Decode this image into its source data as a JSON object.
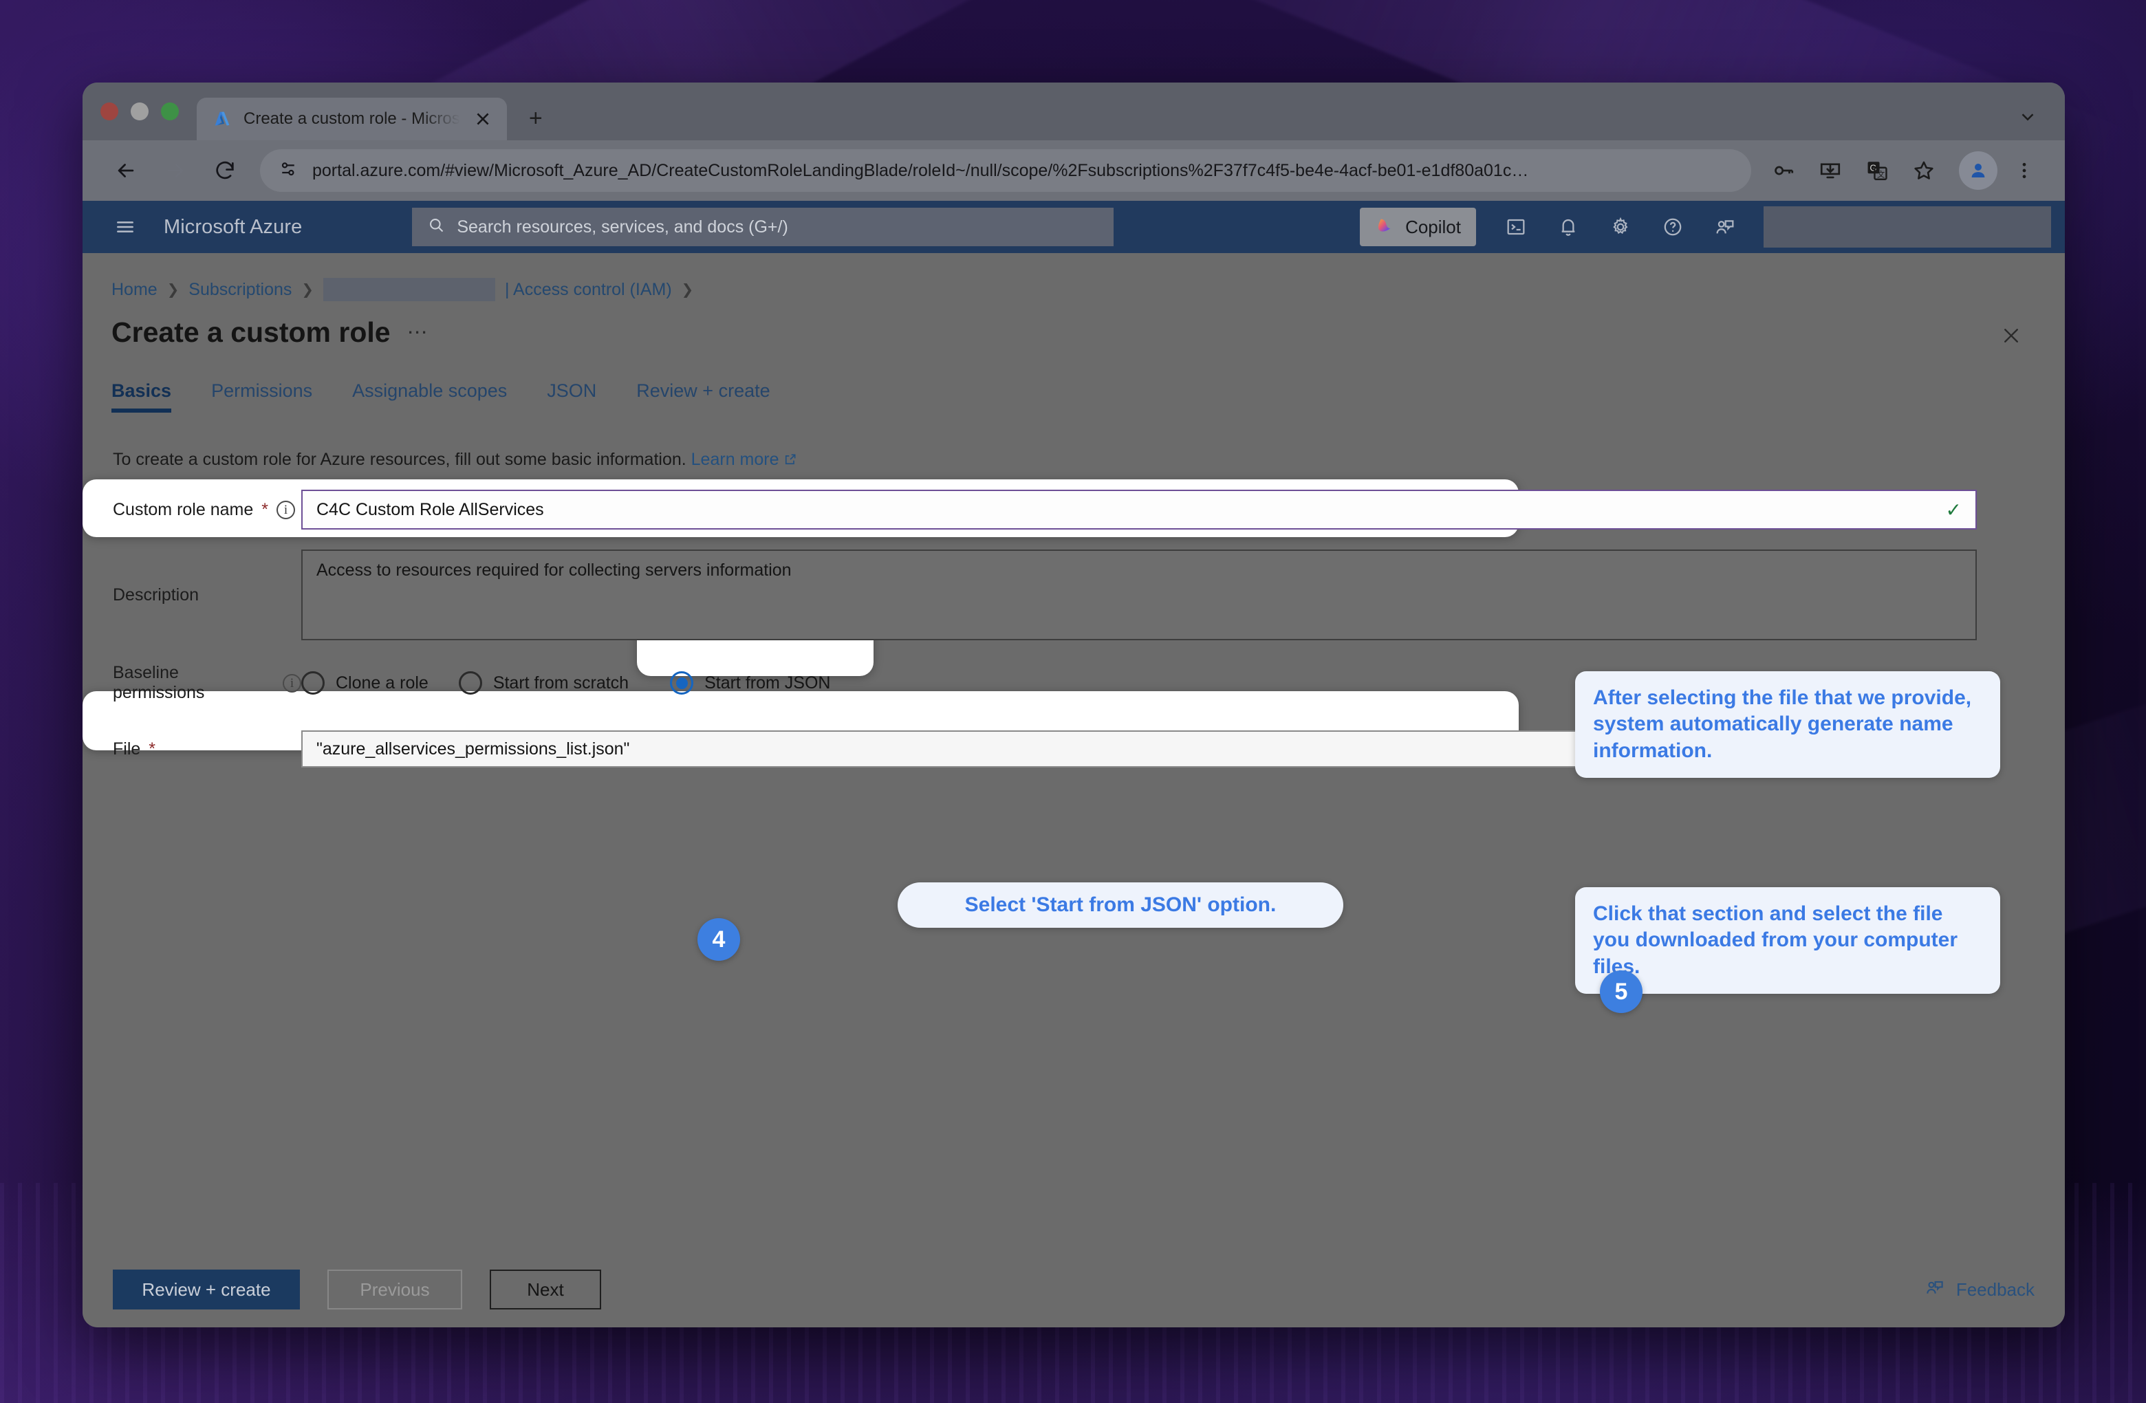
{
  "browser": {
    "tab": {
      "title": "Create a custom role - Micros",
      "favicon": "azure-logo-icon",
      "close": "×"
    },
    "newtab_label": "+",
    "url": "portal.azure.com/#view/Microsoft_Azure_AD/CreateCustomRoleLandingBlade/roleId~/null/scope/%2Fsubscriptions%2F37f7c4f5-be4e-4acf-be01-e1df80a01c…",
    "toolbar_icons": [
      "back-arrow-icon",
      "forward-arrow-icon",
      "reload-icon",
      "site-settings-icon",
      "password-key-icon",
      "install-app-icon",
      "translate-icon",
      "bookmark-star-icon",
      "profile-avatar-icon",
      "chrome-menu-icon"
    ]
  },
  "azure_header": {
    "menu_icon": "hamburger-menu-icon",
    "brand": "Microsoft Azure",
    "search_placeholder": "Search resources, services, and docs (G+/)",
    "search_icon": "search-icon",
    "copilot_label": "Copilot",
    "copilot_icon": "copilot-icon",
    "icons": [
      "cloud-shell-icon",
      "notifications-bell-icon",
      "settings-gear-icon",
      "help-question-icon",
      "feedback-person-icon"
    ],
    "account_redacted": true
  },
  "breadcrumb": {
    "items": [
      {
        "label": "Home",
        "type": "link"
      },
      {
        "label": "Subscriptions",
        "type": "link"
      },
      {
        "label": "",
        "type": "redacted"
      },
      {
        "label": "| Access control (IAM)",
        "type": "link"
      }
    ],
    "separator": "❯"
  },
  "blade": {
    "title": "Create a custom role",
    "more_actions": "⋯",
    "close_icon": "close-icon",
    "tabs": [
      {
        "label": "Basics",
        "active": true
      },
      {
        "label": "Permissions",
        "active": false
      },
      {
        "label": "Assignable scopes",
        "active": false
      },
      {
        "label": "JSON",
        "active": false
      },
      {
        "label": "Review + create",
        "active": false
      }
    ],
    "intro_text": "To create a custom role for Azure resources, fill out some basic information.",
    "intro_link": "Learn more",
    "intro_link_icon": "external-link-icon"
  },
  "form": {
    "role_name": {
      "label": "Custom role name",
      "required_mark": "*",
      "info_icon": "info-icon",
      "value": "C4C Custom Role AllServices",
      "valid_icon": "✓"
    },
    "description": {
      "label": "Description",
      "value": "Access to resources required for collecting servers information"
    },
    "baseline_permissions": {
      "label": "Baseline permissions",
      "info_icon": "info-icon",
      "options": [
        {
          "label": "Clone a role",
          "selected": false
        },
        {
          "label": "Start from scratch",
          "selected": false
        },
        {
          "label": "Start from JSON",
          "selected": true
        }
      ]
    },
    "file": {
      "label": "File",
      "required_mark": "*",
      "value": "\"azure_allservices_permissions_list.json\"",
      "browse_icon": "folder-open-icon"
    }
  },
  "annotations": {
    "callout_1": "After selecting the file that we provide, system automatically generate name information.",
    "callout_2": "Select 'Start from JSON' option.",
    "callout_3": "Click that section and select the file you downloaded from your computer files.",
    "badge_4": "4",
    "badge_5": "5",
    "accent_color": "#3d7fe0",
    "callout_bg": "#eef3fc"
  },
  "footer": {
    "review_create": "Review + create",
    "previous": "Previous",
    "next": "Next",
    "feedback": "Feedback",
    "feedback_icon": "feedback-person-icon"
  }
}
